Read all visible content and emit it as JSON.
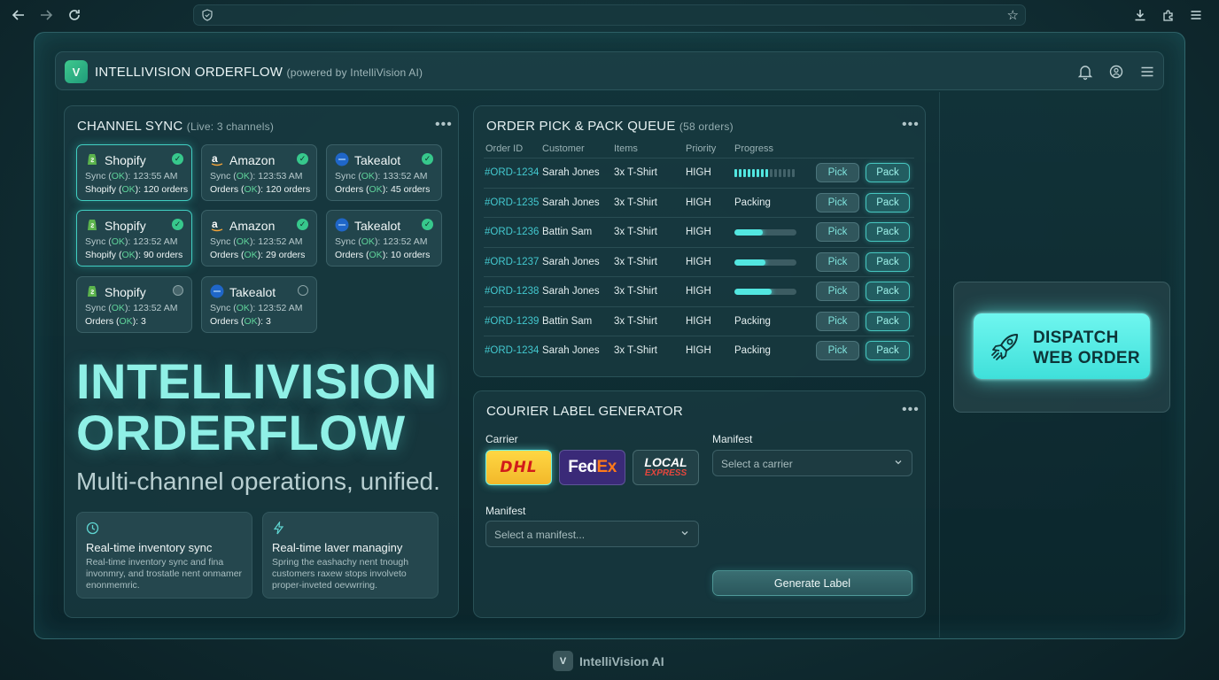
{
  "browser": {
    "back_icon": "arrow-left-icon",
    "forward_icon": "arrow-right-icon",
    "reload_icon": "reload-icon",
    "shield_icon": "shield-icon",
    "bookmark_icon": "star-icon",
    "download_icon": "download-icon",
    "extensions_icon": "puzzle-icon",
    "menu_icon": "hamburger-icon"
  },
  "header": {
    "logo_letter": "V",
    "title": "INTELLIVISION ORDERFLOW",
    "subtitle": "(powered by IntelliVision AI)"
  },
  "channel_sync": {
    "title": "CHANNEL SYNC",
    "subtitle": "(Live: 3 channels)",
    "tiles": [
      {
        "name": "Shopify",
        "sync_prefix": "Sync (",
        "sync_status": "OK",
        "sync_suffix": "): 123:55 AM",
        "orders_prefix": "Shopify (",
        "orders_status": "OK",
        "orders_suffix": "): 120 orders",
        "active": true,
        "state": "ok",
        "brand": "shopify"
      },
      {
        "name": "Amazon",
        "sync_prefix": "Sync (",
        "sync_status": "OK",
        "sync_suffix": "): 123:53 AM",
        "orders_prefix": "Orders (",
        "orders_status": "OK",
        "orders_suffix": "): 120 orders",
        "active": false,
        "state": "ok",
        "brand": "amazon"
      },
      {
        "name": "Takealot",
        "sync_prefix": "Sync (",
        "sync_status": "OK",
        "sync_suffix": "): 133:52 AM",
        "orders_prefix": "Orders (",
        "orders_status": "OK",
        "orders_suffix": "): 45 orders",
        "active": false,
        "state": "ok",
        "brand": "takealot"
      },
      {
        "name": "Shopify",
        "sync_prefix": "Sync (",
        "sync_status": "OK",
        "sync_suffix": "): 123:52 AM",
        "orders_prefix": "Shopify (",
        "orders_status": "OK",
        "orders_suffix": "): 90 orders",
        "active": true,
        "state": "ok",
        "brand": "shopify"
      },
      {
        "name": "Amazon",
        "sync_prefix": "Sync (",
        "sync_status": "OK",
        "sync_suffix": "): 123:52 AM",
        "orders_prefix": "Orders (",
        "orders_status": "OK",
        "orders_suffix": "): 29 orders",
        "active": false,
        "state": "ok",
        "brand": "amazon"
      },
      {
        "name": "Takealot",
        "sync_prefix": "Sync (",
        "sync_status": "OK",
        "sync_suffix": "): 123:52 AM",
        "orders_prefix": "Orders (",
        "orders_status": "OK",
        "orders_suffix": "): 10 orders",
        "active": false,
        "state": "ok",
        "brand": "takealot"
      },
      {
        "name": "Shopify",
        "sync_prefix": "Sync (",
        "sync_status": "OK",
        "sync_suffix": "): 123:52 AM",
        "orders_prefix": "Orders (",
        "orders_status": "OK",
        "orders_suffix": "): 3",
        "active": false,
        "state": "pending",
        "brand": "shopify"
      },
      {
        "name": "Takealot",
        "sync_prefix": "Sync (",
        "sync_status": "OK",
        "sync_suffix": "): 123:52 AM",
        "orders_prefix": "Orders (",
        "orders_status": "OK",
        "orders_suffix": "): 3",
        "active": false,
        "state": "idle",
        "brand": "takealot"
      }
    ]
  },
  "hero": {
    "line1": "INTELLIVISION",
    "line2": "ORDERFLOW",
    "tagline": "Multi-channel operations, unified."
  },
  "features": [
    {
      "icon": "clock-icon",
      "title": "Real-time inventory sync",
      "desc": "Real-time inventory sync and fina invonmry, and trostatle nent onmamer enonmemric."
    },
    {
      "icon": "lightning-icon",
      "title": "Real-time laver managiny",
      "desc": "Spring the eashachy nent tnough customers raxew stops involveto proper-inveted oevwrring."
    }
  ],
  "queue": {
    "title": "ORDER PICK & PACK QUEUE",
    "subtitle": "(58 orders)",
    "columns": [
      "Order ID",
      "Customer",
      "Items",
      "Priority",
      "Progress"
    ],
    "pick_label": "Pick",
    "pack_label": "Pack",
    "rows": [
      {
        "id": "#ORD-1234",
        "customer": "Sarah Jones",
        "items": "3x T-Shirt",
        "priority": "HIGH",
        "progress_type": "segments",
        "progress": 0.6,
        "status": ""
      },
      {
        "id": "#ORD-1235",
        "customer": "Sarah Jones",
        "items": "3x T-Shirt",
        "priority": "HIGH",
        "progress_type": "text",
        "progress": 0,
        "status": "Packing"
      },
      {
        "id": "#ORD-1236",
        "customer": "Battin Sam",
        "items": "3x T-Shirt",
        "priority": "HIGH",
        "progress_type": "bar",
        "progress": 0.45,
        "status": ""
      },
      {
        "id": "#ORD-1237",
        "customer": "Sarah Jones",
        "items": "3x T-Shirt",
        "priority": "HIGH",
        "progress_type": "bar",
        "progress": 0.5,
        "status": ""
      },
      {
        "id": "#ORD-1238",
        "customer": "Sarah Jones",
        "items": "3x T-Shirt",
        "priority": "HIGH",
        "progress_type": "bar",
        "progress": 0.6,
        "status": ""
      },
      {
        "id": "#ORD-1239",
        "customer": "Battin Sam",
        "items": "3x T-Shirt",
        "priority": "HIGH",
        "progress_type": "text",
        "progress": 0,
        "status": "Packing"
      },
      {
        "id": "#ORD-1234",
        "customer": "Sarah Jones",
        "items": "3x T-Shirt",
        "priority": "HIGH",
        "progress_type": "text",
        "progress": 0,
        "status": "Packing"
      }
    ]
  },
  "courier": {
    "title": "COURIER LABEL GENERATOR",
    "carrier_label": "Carrier",
    "carriers": [
      {
        "name": "DHL",
        "selected": true
      },
      {
        "name_a": "Fed",
        "name_b": "Ex",
        "selected": false
      },
      {
        "name_a": "LOCAL",
        "name_b": "EXPRESS",
        "selected": false
      }
    ],
    "manifest_label_right": "Manifest",
    "carrier_select_placeholder": "Select a carrier",
    "manifest_label": "Manifest",
    "manifest_select_placeholder": "Select a manifest...",
    "generate_label": "Generate Label"
  },
  "dispatch": {
    "line1": "DISPATCH",
    "line2": "WEB ORDER"
  },
  "footer": {
    "logo_letter": "V",
    "text": "IntelliVision AI"
  },
  "colors": {
    "accent": "#52e6e0",
    "ok_green": "#37c88c",
    "order_id": "#43c8cf",
    "hero": "#8ff0e6"
  }
}
